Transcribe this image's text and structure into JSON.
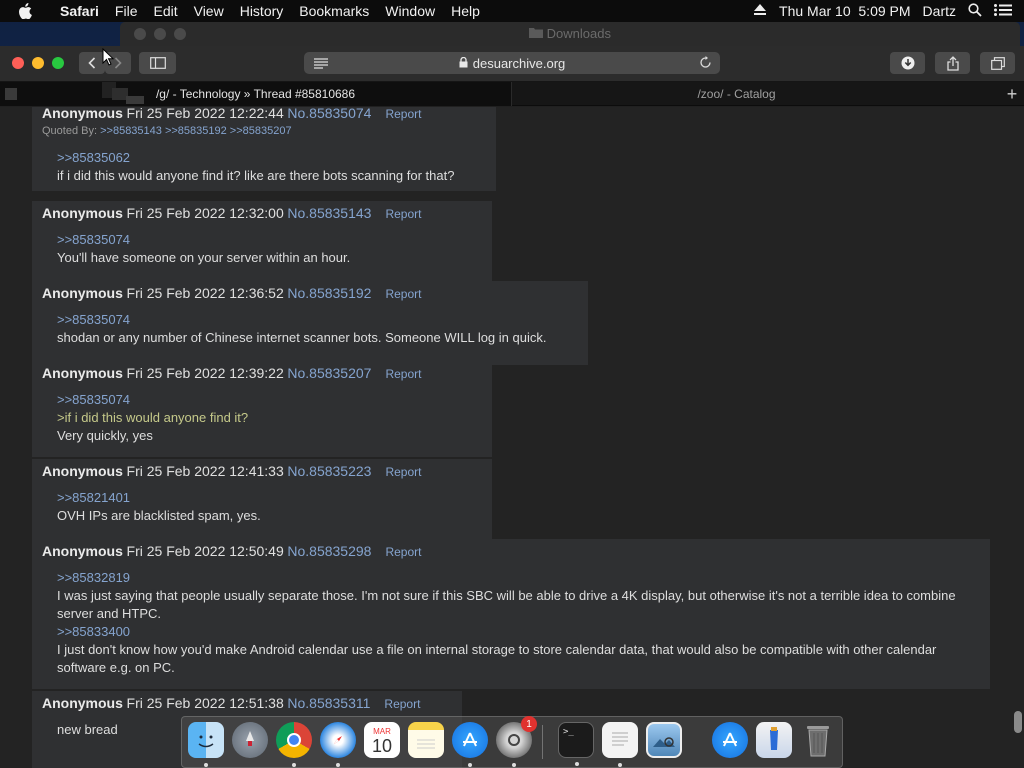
{
  "menubar": {
    "app": "Safari",
    "items": [
      "File",
      "Edit",
      "View",
      "History",
      "Bookmarks",
      "Window",
      "Help"
    ],
    "datetime": "Thu Mar 10  5:09 PM",
    "user": "Dartz"
  },
  "background_window": {
    "title": "Downloads"
  },
  "safari": {
    "url": "desuarchive.org",
    "tabs": [
      {
        "label": "/g/ - Technology » Thread #85810686",
        "active": true
      },
      {
        "label": "/zoo/ - Catalog",
        "active": false
      }
    ]
  },
  "posts": [
    {
      "name": "Anonymous",
      "date": "Fri 25 Feb 2022 12:22:44",
      "number": "No.85835074",
      "report": "Report",
      "quoted_label": "Quoted By:",
      "quoted_by": ">>85835143 >>85835192 >>85835207",
      "lines": [
        {
          "text": ">>85835062",
          "kind": "link"
        },
        {
          "text": "if i did this would anyone find it? like are there bots scanning for that?",
          "kind": "text"
        }
      ]
    },
    {
      "name": "Anonymous",
      "date": "Fri 25 Feb 2022 12:32:00",
      "number": "No.85835143",
      "report": "Report",
      "lines": [
        {
          "text": ">>85835074",
          "kind": "link"
        },
        {
          "text": "You'll have someone on your server within an hour.",
          "kind": "text"
        }
      ]
    },
    {
      "name": "Anonymous",
      "date": "Fri 25 Feb 2022 12:36:52",
      "number": "No.85835192",
      "report": "Report",
      "lines": [
        {
          "text": ">>85835074",
          "kind": "link"
        },
        {
          "text": "shodan or any number of Chinese internet scanner bots. Someone WILL log in quick.",
          "kind": "text"
        }
      ]
    },
    {
      "name": "Anonymous",
      "date": "Fri 25 Feb 2022 12:39:22",
      "number": "No.85835207",
      "report": "Report",
      "lines": [
        {
          "text": ">>85835074",
          "kind": "link"
        },
        {
          "text": ">if i did this would anyone find it?",
          "kind": "green"
        },
        {
          "text": "Very quickly, yes",
          "kind": "text"
        }
      ]
    },
    {
      "name": "Anonymous",
      "date": "Fri 25 Feb 2022 12:41:33",
      "number": "No.85835223",
      "report": "Report",
      "lines": [
        {
          "text": ">>85821401",
          "kind": "link"
        },
        {
          "text": "OVH IPs are blacklisted spam, yes.",
          "kind": "text"
        }
      ]
    },
    {
      "name": "Anonymous",
      "date": "Fri 25 Feb 2022 12:50:49",
      "number": "No.85835298",
      "report": "Report",
      "lines": [
        {
          "text": ">>85832819",
          "kind": "link"
        },
        {
          "text": "I was just saying that people usually separate those. I'm not sure if this SBC will be able to drive a 4K display, but otherwise it's not a terrible idea to combine",
          "kind": "text"
        },
        {
          "text": "server and HTPC.",
          "kind": "text"
        },
        {
          "text": ">>85833400",
          "kind": "link"
        },
        {
          "text": "I just don't know how you'd make Android calendar use a file on internal storage to store calendar data, that would also be compatible with other calendar",
          "kind": "text"
        },
        {
          "text": "software e.g. on PC.",
          "kind": "text"
        }
      ]
    },
    {
      "name": "Anonymous",
      "date": "Fri 25 Feb 2022 12:51:38",
      "number": "No.85835311",
      "report": "Report",
      "lines": [
        {
          "text": "new bread",
          "kind": "text"
        }
      ]
    }
  ],
  "dock": {
    "apps": [
      "finder-icon",
      "launchpad-icon",
      "chrome-icon",
      "safari-icon",
      "calendar-icon",
      "notes-icon",
      "app-store-icon",
      "system-preferences-icon",
      "terminal-icon",
      "textedit-icon",
      "preview-icon",
      "app-store-icon",
      "app-icon",
      "trash-icon"
    ],
    "calendar_month": "MAR",
    "calendar_day": "10",
    "sysprefs_badge": "1",
    "terminal_prompt": ">_"
  },
  "colors": {
    "link": "#85a4cf",
    "greentext": "#c5c98a",
    "post_bg": "#2f3032",
    "page_bg": "#232323"
  }
}
